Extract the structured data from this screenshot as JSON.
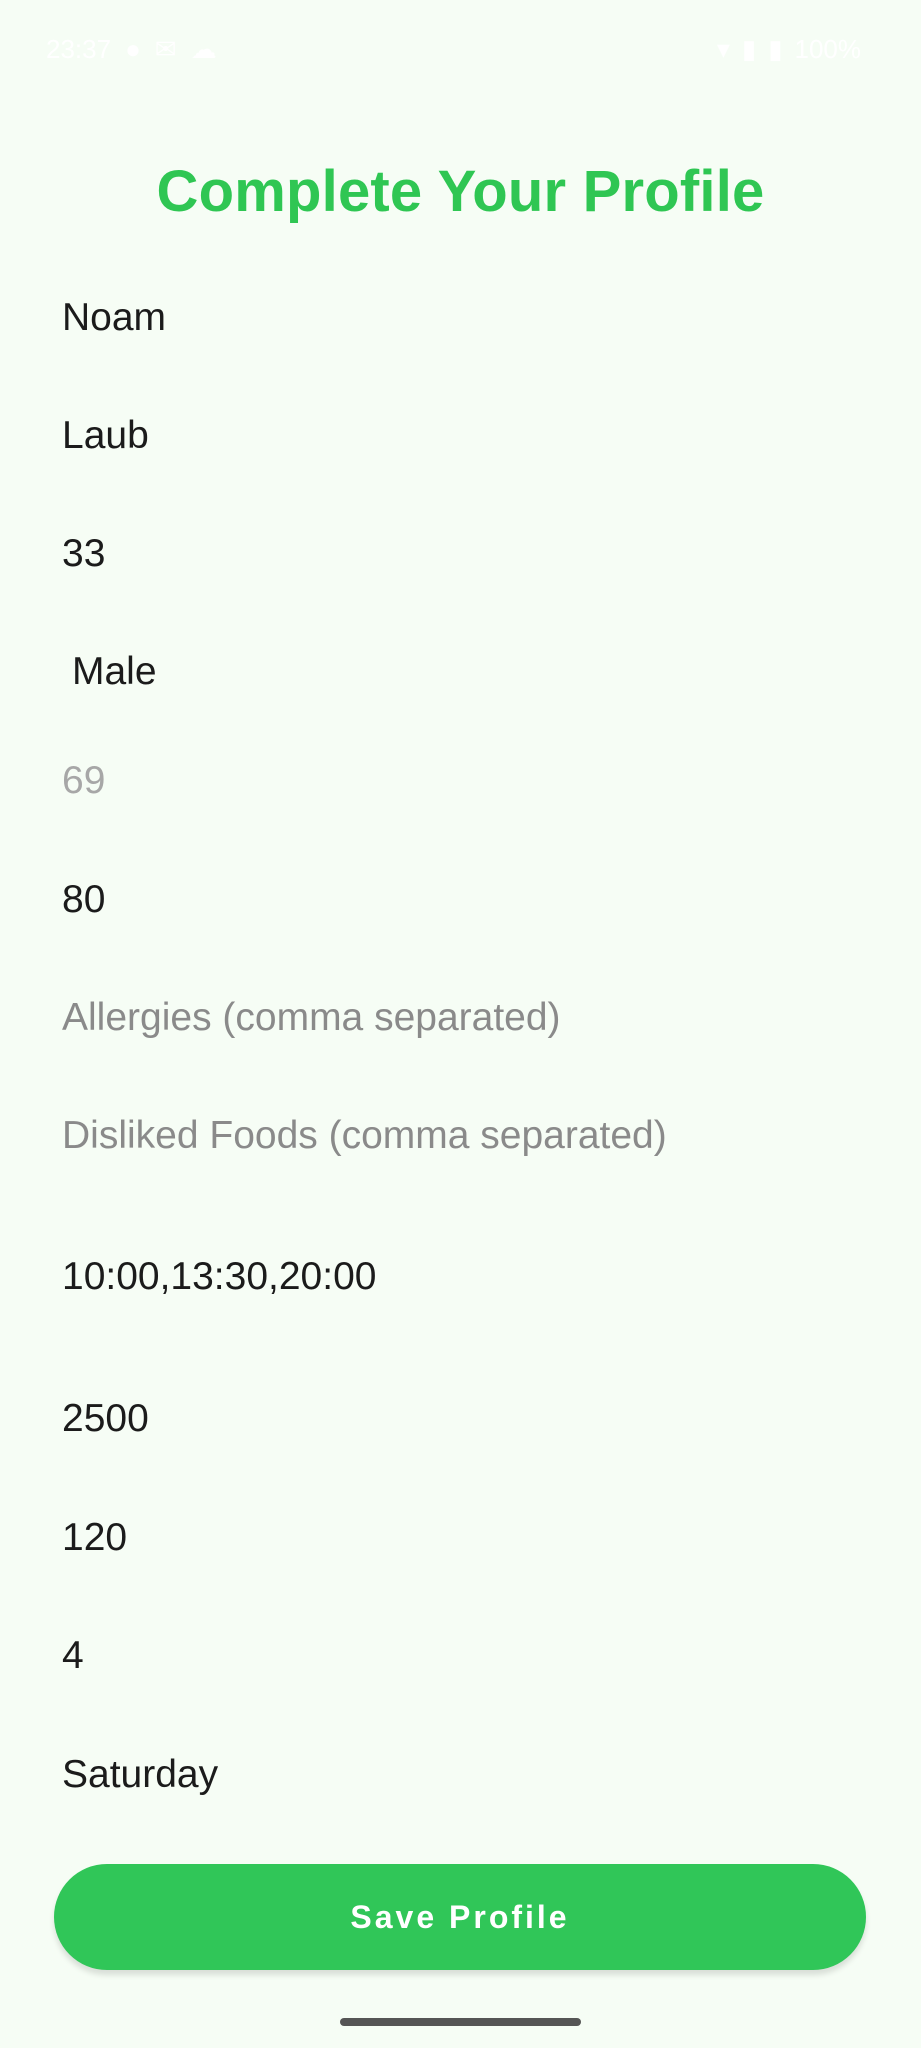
{
  "status_bar": {
    "time": "23:37",
    "battery": "100%",
    "colors": {
      "text": "#ffffff"
    },
    "icons": [
      "signal-icon",
      "wifi-icon",
      "battery-icon"
    ]
  },
  "page": {
    "title": "Complete Your Profile"
  },
  "form": {
    "first_name": "Noam",
    "last_name": "Laub",
    "age": "33",
    "gender": "Male",
    "height_hint": "69",
    "weight": "80",
    "allergies_placeholder": "Allergies (comma separated)",
    "disliked_foods_placeholder": "Disliked Foods (comma separated)",
    "meal_times": "10:00,13:30,20:00",
    "calories": "2500",
    "protein": "120",
    "workouts": "4",
    "weekday": "Saturday"
  },
  "actions": {
    "save_label": "Save Profile"
  },
  "colors": {
    "accent": "#30c658",
    "background": "#f6fdf5"
  }
}
